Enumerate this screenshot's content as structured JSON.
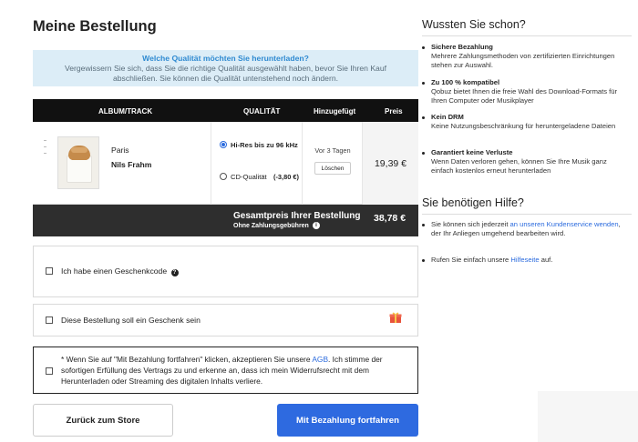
{
  "page": {
    "title": "Meine Bestellung"
  },
  "notice": {
    "question": "Welche Qualität möchten Sie herunterladen?",
    "line1": "Vergewissern Sie sich, dass Sie die richtige Qualität ausgewählt haben, bevor Sie Ihren Kauf",
    "line2": "abschließen. Sie können die Qualität untenstehend noch ändern."
  },
  "table": {
    "headers": {
      "album": "ALBUM/TRACK",
      "quality": "QUALITÄT",
      "added": "Hinzugefügt",
      "price": "Preis"
    },
    "item": {
      "title": "Paris",
      "artist": "Nils Frahm",
      "quality_hires": "Hi-Res bis zu 96 kHz",
      "quality_cd": "CD-Qualität",
      "quality_cd_price": "(-3,80 €)",
      "added": "Vor 3 Tagen",
      "remove_label": "Löschen",
      "price": "19,39 €"
    }
  },
  "total": {
    "label": "Gesamtpreis Ihrer Bestellung",
    "sub": "Ohne Zahlungsgebühren",
    "info": "i",
    "price": "38,78 €"
  },
  "options": {
    "gift_code": "Ich habe einen Geschenkcode",
    "gift_code_help": "?",
    "is_gift": "Diese Bestellung soll ein Geschenk sein"
  },
  "terms": {
    "before_link": "* Wenn Sie auf \"Mit Bezahlung fortfahren\" klicken, akzeptieren Sie unsere ",
    "link": "AGB",
    "after_link": ". Ich stimme der sofortigen Erfüllung des Vertrags zu und erkenne an, dass ich mein Widerrufsrecht mit dem Herunterladen oder Streaming des digitalen Inhalts verliere."
  },
  "buttons": {
    "back": "Zurück zum Store",
    "pay": "Mit Bezahlung fortfahren"
  },
  "sidebar": {
    "did_you_know_title": "Wussten Sie schon?",
    "tips": [
      {
        "title": "Sichere Bezahlung",
        "desc": "Mehrere Zahlungsmethoden von zertifizierten Einrichtungen stehen zur Auswahl."
      },
      {
        "title": "Zu 100 % kompatibel",
        "desc": "Qobuz bietet Ihnen die freie Wahl des Download-Formats für Ihren Computer oder Musikplayer"
      },
      {
        "title": "Kein DRM",
        "desc": "Keine Nutzungsbeschränkung für heruntergeladene Dateien"
      },
      {
        "title": "Garantiert keine Verluste",
        "desc": "Wenn Daten verloren gehen, können Sie Ihre Musik ganz einfach kostenlos erneut herunterladen"
      }
    ],
    "help_title": "Sie benötigen Hilfe?",
    "help1_before": "Sie können sich jederzeit ",
    "help1_link": "an unseren Kundenservice wenden",
    "help1_after": ", der Ihr Anliegen umgehend bearbeiten wird.",
    "help2_before": "Rufen Sie einfach unsere ",
    "help2_link": "Hilfeseite",
    "help2_after": " auf."
  },
  "colors": {
    "accent": "#2e6ae0",
    "notice_bg": "#dcedf7",
    "header_bg": "#111111",
    "total_bg": "#2e2e2e",
    "gift": "#e8533c"
  }
}
